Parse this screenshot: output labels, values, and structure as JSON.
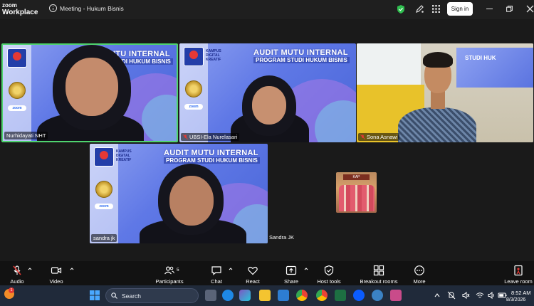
{
  "app": {
    "brand_line1": "zoom",
    "brand_line2": "Workplace",
    "meeting_title": "Meeting - Hukum Bisnis",
    "signin_label": "Sign in"
  },
  "banner": {
    "title": "AUDIT MUTU INTERNAL",
    "subtitle": "PROGRAM STUDI HUKUM BISNIS",
    "partial_title": "UTU INTERNAL",
    "partial_subtitle": "STUDI HUKUM BISNIS",
    "tile3_fragment": "STUDI HUK",
    "campus_line1": "KAMPUS",
    "campus_line2": "DIGITAL",
    "campus_line3": "KREATIF",
    "uni_label": "UNIVERSITAS",
    "zoom_chip": "zoom"
  },
  "participants": [
    {
      "name": "Nurhidayati NHT",
      "muted": false
    },
    {
      "name": "UBSI-Ela Nurelasari",
      "muted": true
    },
    {
      "name": "Sona Asnawi",
      "muted": true
    },
    {
      "name": "sandra jk",
      "muted": false
    }
  ],
  "self_view": {
    "name": "Sandra JK",
    "sign_text": "KAP"
  },
  "toolbar": {
    "audio": "Audio",
    "video": "Video",
    "participants": "Participants",
    "participants_count": "5",
    "chat": "Chat",
    "react": "React",
    "share": "Share",
    "host_tools": "Host tools",
    "breakout_rooms": "Breakout rooms",
    "more": "More",
    "leave": "Leave room"
  },
  "taskbar": {
    "search_label": "Search",
    "time": "8:52 AM",
    "date": "8/3/2026",
    "weather_count": "1"
  },
  "colors": {
    "active_speaker": "#4fd36e",
    "banner_blue": "#5f78e6",
    "signin_bg": "#ffffff",
    "leave": "#e53935"
  }
}
